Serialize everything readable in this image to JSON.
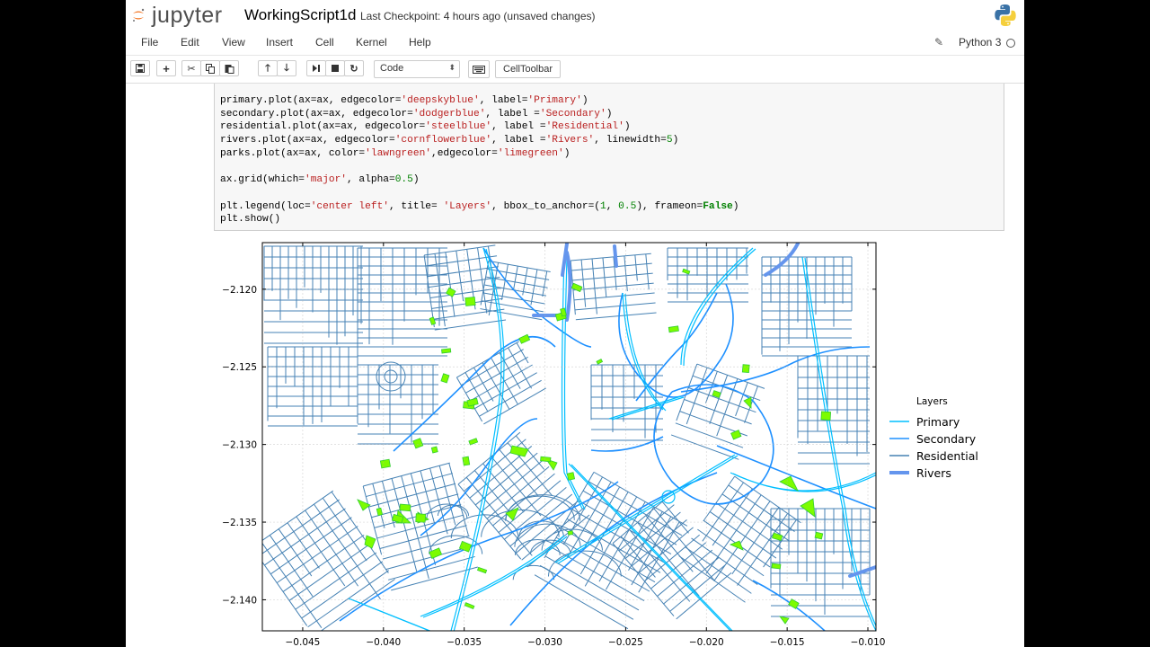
{
  "header": {
    "logo_text": "jupyter",
    "notebook_title": "WorkingScript1d",
    "checkpoint": "Last Checkpoint: 4 hours ago (unsaved changes)"
  },
  "menu": [
    "File",
    "Edit",
    "View",
    "Insert",
    "Cell",
    "Kernel",
    "Help"
  ],
  "kernel_name": "Python 3",
  "toolbar": {
    "cell_type": "Code",
    "celltoolbar_label": "CellToolbar",
    "icons": [
      "save-icon",
      "plus-icon",
      "cut-icon",
      "copy-icon",
      "paste-icon",
      "arrow-up-icon",
      "arrow-down-icon",
      "step-forward-icon",
      "stop-icon",
      "refresh-icon",
      "keyboard-icon"
    ]
  },
  "code_lines": [
    "primary.plot(ax=ax, edgecolor='deepskyblue', label='Primary')",
    "secondary.plot(ax=ax, edgecolor='dodgerblue', label ='Secondary')",
    "residential.plot(ax=ax, edgecolor='steelblue', label ='Residential')",
    "rivers.plot(ax=ax, edgecolor='cornflowerblue', label ='Rivers', linewidth=5)",
    "parks.plot(ax=ax, color='lawngreen',edgecolor='limegreen')",
    "",
    "ax.grid(which='major', alpha=0.5)",
    "",
    "plt.legend(loc='center left', title= 'Layers', bbox_to_anchor=(1, 0.5), frameon=False)",
    "plt.show()"
  ],
  "chart_data": {
    "type": "map",
    "x_ticks": [
      "−0.045",
      "−0.040",
      "−0.035",
      "−0.030",
      "−0.025",
      "−0.020",
      "−0.015",
      "−0.010"
    ],
    "y_ticks": [
      "−2.120",
      "−2.125",
      "−2.130",
      "−2.135",
      "−2.140"
    ],
    "xlim": [
      -0.0475,
      -0.0095
    ],
    "ylim": [
      -2.142,
      -2.117
    ],
    "grid": true,
    "legend": {
      "title": "Layers",
      "placement": "center left, outside right",
      "entries": [
        {
          "label": "Primary",
          "color": "#00bfff"
        },
        {
          "label": "Secondary",
          "color": "#1e90ff"
        },
        {
          "label": "Residential",
          "color": "#4682b4"
        },
        {
          "label": "Rivers",
          "color": "#6495ed"
        }
      ]
    },
    "parks_color": "#7cfc00"
  }
}
